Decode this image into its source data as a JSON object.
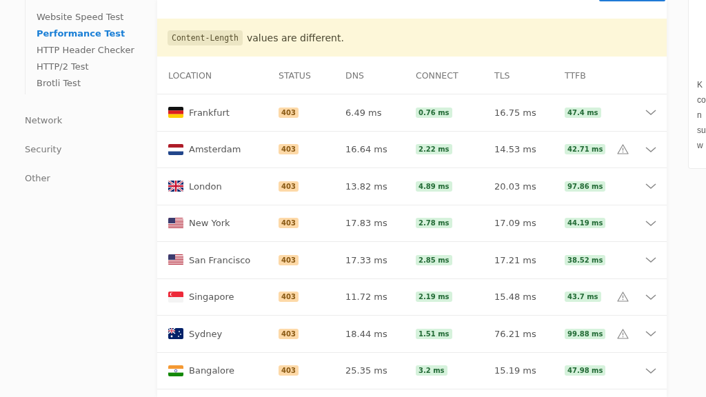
{
  "sidebar": {
    "sub_items": [
      {
        "label": "Website Speed Test",
        "selected": false
      },
      {
        "label": "Performance Test",
        "selected": true
      },
      {
        "label": "HTTP Header Checker",
        "selected": false
      },
      {
        "label": "HTTP/2 Test",
        "selected": false
      },
      {
        "label": "Brotli Test",
        "selected": false
      }
    ],
    "sections": [
      "Network",
      "Security",
      "Other"
    ]
  },
  "alert": {
    "code": "Content-Length",
    "message": "values are different."
  },
  "table": {
    "columns": [
      "LOCATION",
      "STATUS",
      "DNS",
      "CONNECT",
      "TLS",
      "TTFB"
    ],
    "rows": [
      {
        "kind": "de",
        "location": "Frankfurt",
        "status": "403",
        "dns": "6.49 ms",
        "connect": "0.76 ms",
        "tls": "16.75 ms",
        "ttfb": "47.4 ms",
        "warning": false
      },
      {
        "kind": "nl",
        "location": "Amsterdam",
        "status": "403",
        "dns": "16.64 ms",
        "connect": "2.22 ms",
        "tls": "14.53 ms",
        "ttfb": "42.71 ms",
        "warning": true
      },
      {
        "kind": "gb",
        "location": "London",
        "status": "403",
        "dns": "13.82 ms",
        "connect": "4.89 ms",
        "tls": "20.03 ms",
        "ttfb": "97.86 ms",
        "warning": false
      },
      {
        "kind": "us",
        "location": "New York",
        "status": "403",
        "dns": "17.83 ms",
        "connect": "2.78 ms",
        "tls": "17.09 ms",
        "ttfb": "44.19 ms",
        "warning": false
      },
      {
        "kind": "us",
        "location": "San Francisco",
        "status": "403",
        "dns": "17.33 ms",
        "connect": "2.85 ms",
        "tls": "17.21 ms",
        "ttfb": "38.52 ms",
        "warning": false
      },
      {
        "kind": "sg",
        "location": "Singapore",
        "status": "403",
        "dns": "11.72 ms",
        "connect": "2.19 ms",
        "tls": "15.48 ms",
        "ttfb": "43.7 ms",
        "warning": true
      },
      {
        "kind": "au",
        "location": "Sydney",
        "status": "403",
        "dns": "18.44 ms",
        "connect": "1.51 ms",
        "tls": "76.21 ms",
        "ttfb": "99.88 ms",
        "warning": true
      },
      {
        "kind": "in",
        "location": "Bangalore",
        "status": "403",
        "dns": "25.35 ms",
        "connect": "3.2 ms",
        "tls": "15.19 ms",
        "ttfb": "47.98 ms",
        "warning": false
      }
    ]
  },
  "side_panel": {
    "lines": [
      "K",
      "co",
      "n",
      "su",
      "w"
    ]
  }
}
